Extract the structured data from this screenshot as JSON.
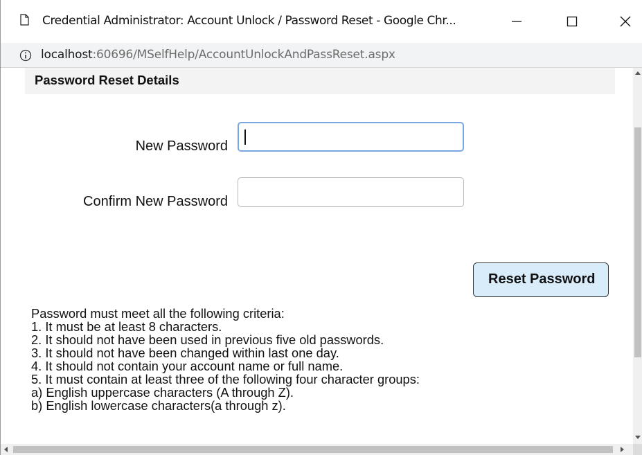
{
  "window": {
    "title": "Credential Administrator: Account Unlock / Password Reset - Google Chr..."
  },
  "address": {
    "host": "localhost",
    "rest": ":60696/MSelfHelp/AccountUnlockAndPassReset.aspx"
  },
  "form": {
    "section_title": "Password Reset Details",
    "new_password_label": "New Password",
    "new_password_value": "",
    "confirm_password_label": "Confirm New Password",
    "confirm_password_value": "",
    "reset_button_label": "Reset Password"
  },
  "criteria": {
    "lines": [
      "Password must meet all the following criteria:",
      "1. It must be at least 8 characters.",
      "2. It should not have been used in previous five old passwords.",
      "3. It should not have been changed within last one day.",
      "4. It should not contain your account name or full name.",
      "5. It must contain at least three of the following four character groups:",
      "a) English uppercase characters (A through Z).",
      "b) English lowercase characters(a through z)."
    ]
  },
  "icons": {
    "tab_icon": "document-icon",
    "site_info": "info-icon",
    "minimize": "minimize-icon",
    "maximize": "maximize-icon",
    "close": "close-icon"
  }
}
